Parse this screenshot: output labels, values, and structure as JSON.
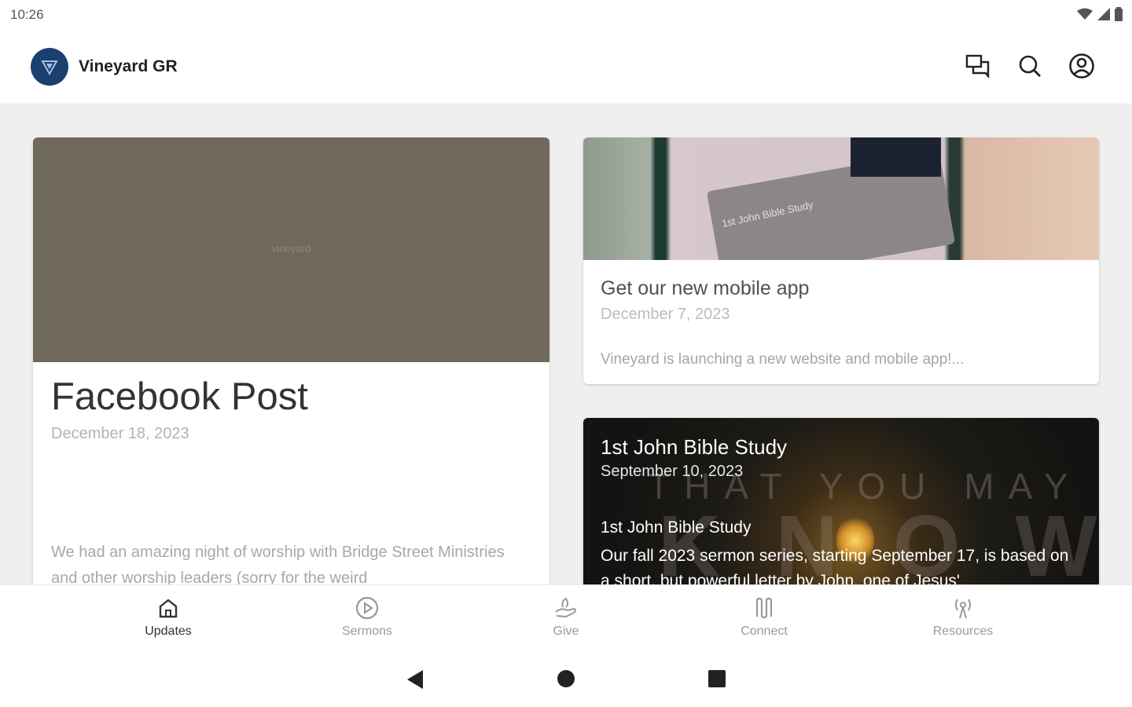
{
  "status": {
    "time": "10:26"
  },
  "app": {
    "title": "Vineyard GR"
  },
  "cards": {
    "facebook": {
      "watermark": "vineyard",
      "title": "Facebook Post",
      "date": "December 18, 2023",
      "body": "We had an amazing night of worship with Bridge Street Ministries and other worship leaders (sorry for the weird"
    },
    "app": {
      "image_text": "1st John Bible Study",
      "title": "Get our new mobile app",
      "date": "December 7, 2023",
      "description": "Vineyard is launching a new website and mobile app!..."
    },
    "study": {
      "overlay_line1": "THAT YOU MAY",
      "overlay_line2": "KNOW",
      "title": "1st John Bible Study",
      "date": "September 10, 2023",
      "subtitle": "1st John Bible Study",
      "body": "Our fall 2023 sermon series, starting September 17, is based on a short, but powerful letter by John, one of Jesus'"
    }
  },
  "nav": {
    "items": [
      {
        "label": "Updates",
        "icon": "home-icon",
        "active": true
      },
      {
        "label": "Sermons",
        "icon": "play-circle-icon",
        "active": false
      },
      {
        "label": "Give",
        "icon": "give-icon",
        "active": false
      },
      {
        "label": "Connect",
        "icon": "connect-icon",
        "active": false
      },
      {
        "label": "Resources",
        "icon": "broadcast-icon",
        "active": false
      }
    ]
  },
  "colors": {
    "brand": "#1c3f72",
    "background": "#efefef"
  }
}
